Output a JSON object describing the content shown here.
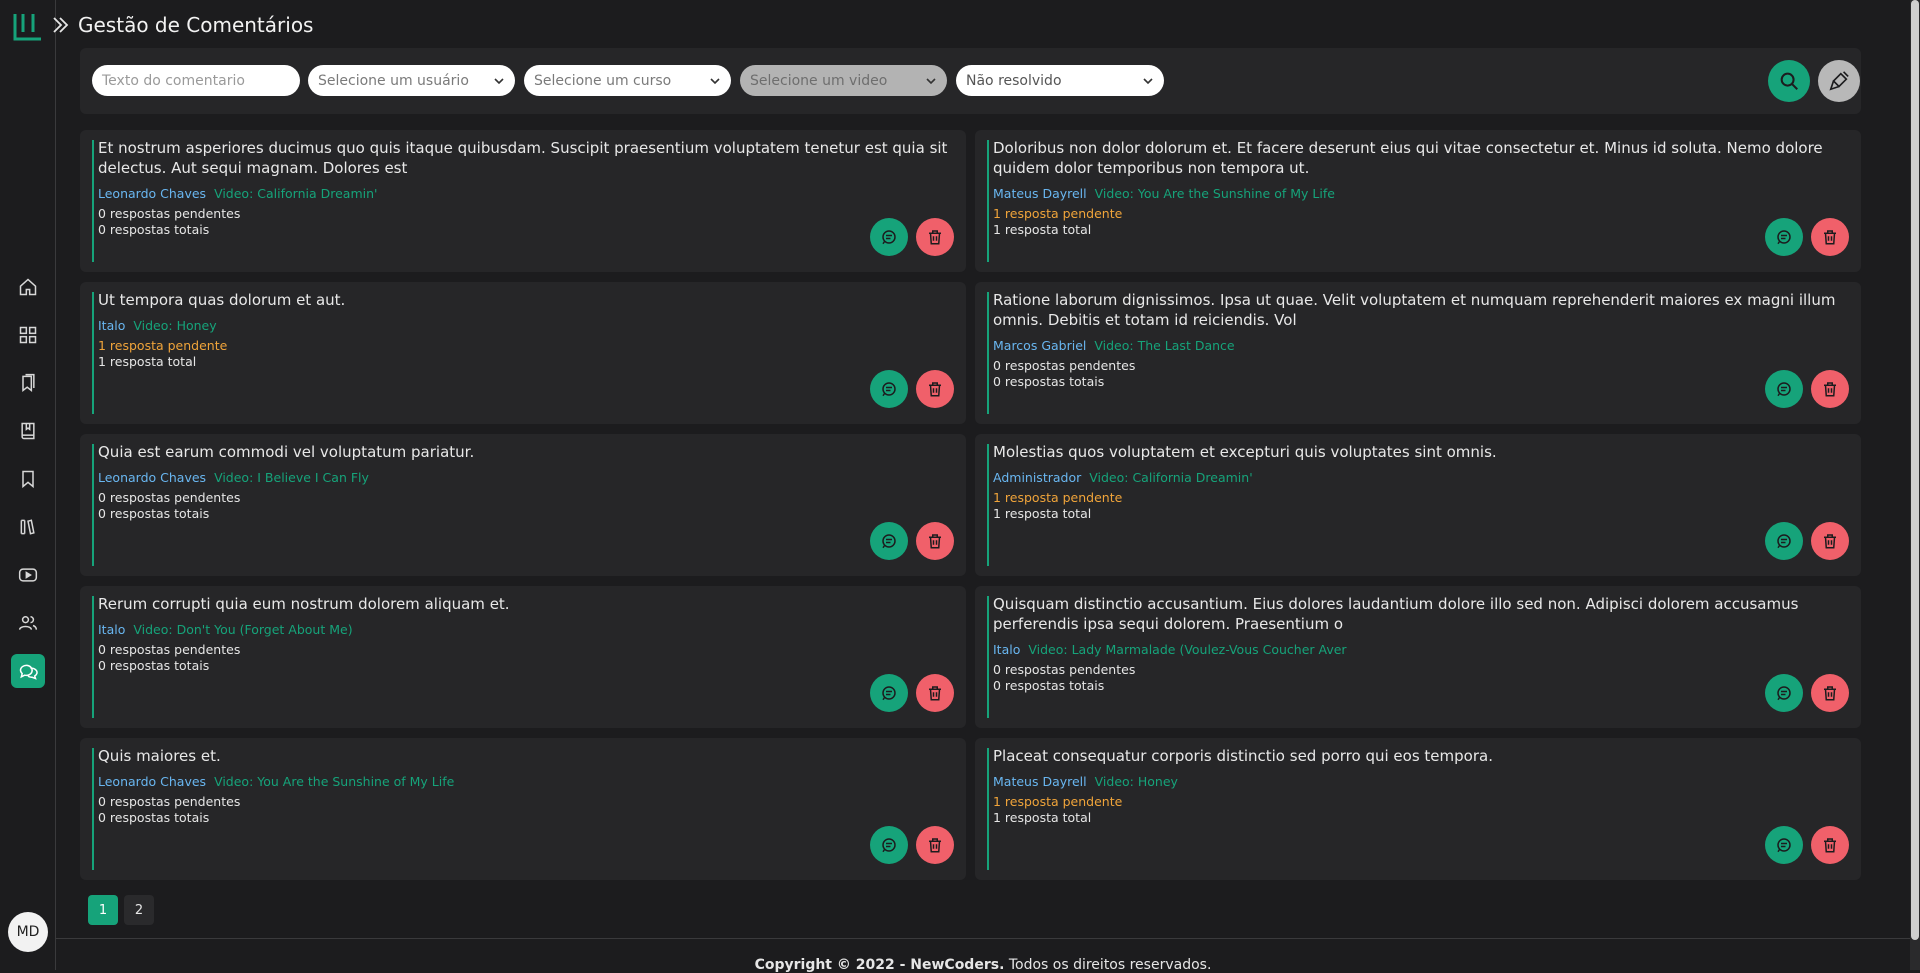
{
  "header": {
    "title": "Gestão de Comentários"
  },
  "filters": {
    "comment_placeholder": "Texto do comentario",
    "user_select": "Selecione um usuário",
    "course_select": "Selecione um curso",
    "video_select": "Selecione um video",
    "status_select": "Não resolvido"
  },
  "colors": {
    "accent": "#16a37a",
    "danger": "#f0606a",
    "user": "#69b6f0",
    "pending": "#f0a43a",
    "bg": "#1c1c1e",
    "card": "#262628"
  },
  "comments": [
    {
      "text": "Et nostrum asperiores ducimus quo quis itaque quibusdam. Suscipit praesentium voluptatem tenetur est quia sit delectus. Aut sequi magnam. Dolores est",
      "user": "Leonardo Chaves",
      "video": "Video: California Dreamin'",
      "pending": "0 respostas pendentes",
      "total": "0 respostas totais",
      "has_pending": false
    },
    {
      "text": "Doloribus non dolor dolorum et. Et facere deserunt eius qui vitae consectetur et. Minus id soluta. Nemo dolore quidem dolor temporibus non tempora ut.",
      "user": "Mateus Dayrell",
      "video": "Video: You Are the Sunshine of My Life",
      "pending": "1 resposta pendente",
      "total": "1 resposta total",
      "has_pending": true
    },
    {
      "text": "Ut tempora quas dolorum et aut.",
      "user": "Italo",
      "video": "Video: Honey",
      "pending": "1 resposta pendente",
      "total": "1 resposta total",
      "has_pending": true
    },
    {
      "text": "Ratione laborum dignissimos. Ipsa ut quae. Velit voluptatem et numquam reprehenderit maiores ex magni illum omnis. Debitis et totam id reiciendis. Vol",
      "user": "Marcos Gabriel",
      "video": "Video: The Last Dance",
      "pending": "0 respostas pendentes",
      "total": "0 respostas totais",
      "has_pending": false
    },
    {
      "text": "Quia est earum commodi vel voluptatum pariatur.",
      "user": "Leonardo Chaves",
      "video": "Video: I Believe I Can Fly",
      "pending": "0 respostas pendentes",
      "total": "0 respostas totais",
      "has_pending": false
    },
    {
      "text": "Molestias quos voluptatem et excepturi quis voluptates sint omnis.",
      "user": "Administrador",
      "video": "Video: California Dreamin'",
      "pending": "1 resposta pendente",
      "total": "1 resposta total",
      "has_pending": true
    },
    {
      "text": "Rerum corrupti quia eum nostrum dolorem aliquam et.",
      "user": "Italo",
      "video": "Video: Don't You (Forget About Me)",
      "pending": "0 respostas pendentes",
      "total": "0 respostas totais",
      "has_pending": false
    },
    {
      "text": "Quisquam distinctio accusantium. Eius dolores laudantium dolore illo sed non. Adipisci dolorem accusamus perferendis ipsa sequi dolorem. Praesentium o",
      "user": "Italo",
      "video": "Video: Lady Marmalade (Voulez-Vous Coucher Aver",
      "pending": "0 respostas pendentes",
      "total": "0 respostas totais",
      "has_pending": false
    },
    {
      "text": "Quis maiores et.",
      "user": "Leonardo Chaves",
      "video": "Video: You Are the Sunshine of My Life",
      "pending": "0 respostas pendentes",
      "total": "0 respostas totais",
      "has_pending": false
    },
    {
      "text": "Placeat consequatur corporis distinctio sed porro qui eos tempora.",
      "user": "Mateus Dayrell",
      "video": "Video: Honey",
      "pending": "1 resposta pendente",
      "total": "1 resposta total",
      "has_pending": true
    }
  ],
  "pagination": {
    "pages": [
      "1",
      "2"
    ],
    "current": "1"
  },
  "user": {
    "initials": "MD"
  },
  "footer": {
    "copyright": "Copyright © 2022 - NewCoders.",
    "rights": " Todos os direitos reservados."
  }
}
